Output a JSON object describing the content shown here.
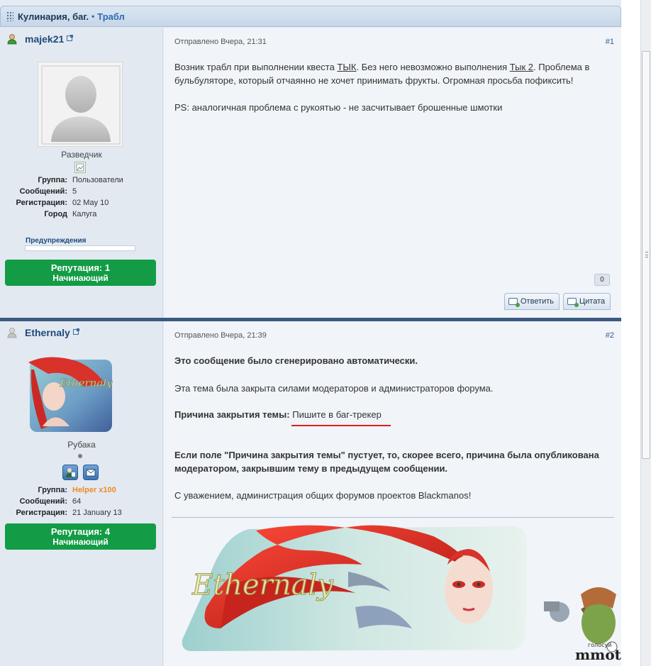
{
  "breadcrumb": {
    "section": "Кулинария, баг.",
    "topic": "Трабл"
  },
  "post1": {
    "username": "majek21",
    "rank": "Разведчик",
    "fields": [
      {
        "label": "Группа:",
        "value": "Пользователи"
      },
      {
        "label": "Сообщений:",
        "value": "5"
      },
      {
        "label": "Регистрация:",
        "value": "02 May 10"
      },
      {
        "label": "Город",
        "value": "Калуга"
      }
    ],
    "warnings_label": "Предупреждения",
    "reputation_label": "Репутация: 1",
    "reputation_level": "Начинающий",
    "posted": "Отправлено Вчера, 21:31",
    "number": "#1",
    "body": {
      "p1_a": "Возник трабл при выполнении квеста ",
      "link1": "ТЫК",
      "p1_b": ". Без него невозможно выполнения ",
      "link2": "Тык 2",
      "p1_c": ". Проблема в бульбуляторе, который отчаянно не хочет принимать фрукты. Огромная просьба пофиксить!",
      "p2": "PS: аналогичная проблема с рукоятью - не засчитывает брошенные шмотки"
    },
    "likes": "0",
    "reply_label": "Ответить",
    "quote_label": "Цитата"
  },
  "post2": {
    "username": "Ethernaly",
    "rank": "Рубака",
    "fields": [
      {
        "label": "Группа:",
        "value": "Helper x100"
      },
      {
        "label": "Сообщений:",
        "value": "64"
      },
      {
        "label": "Регистрация:",
        "value": "21 January 13"
      }
    ],
    "reputation_label": "Репутация: 4",
    "reputation_level": "Начинающий",
    "posted": "Отправлено Вчера, 21:39",
    "number": "#2",
    "body": {
      "auto": "Это сообщение было сгенерировано автоматически.",
      "closed": "Эта тема была закрыта силами модераторов и администраторов форума.",
      "reason_label": "Причина закрытия темы:",
      "reason_value": "Пишите в баг-трекер",
      "empty_note": "Если поле \"Причина закрытия темы\" пустует, то, скорее всего, причина была опубликована модератором, закрывшим тему в предыдущем сообщении.",
      "regards": "С уважением, администрация общих форумов проектов Blackmanos!"
    },
    "avatar_text": "Ethernaly",
    "signature_text": "Ethernaly"
  },
  "ad": {
    "line1": "голосуй",
    "line2": "mmotop"
  },
  "colors": {
    "reputation_bg": "#139c45",
    "helper_group": "#ef8b25",
    "underline": "#d9221c"
  }
}
